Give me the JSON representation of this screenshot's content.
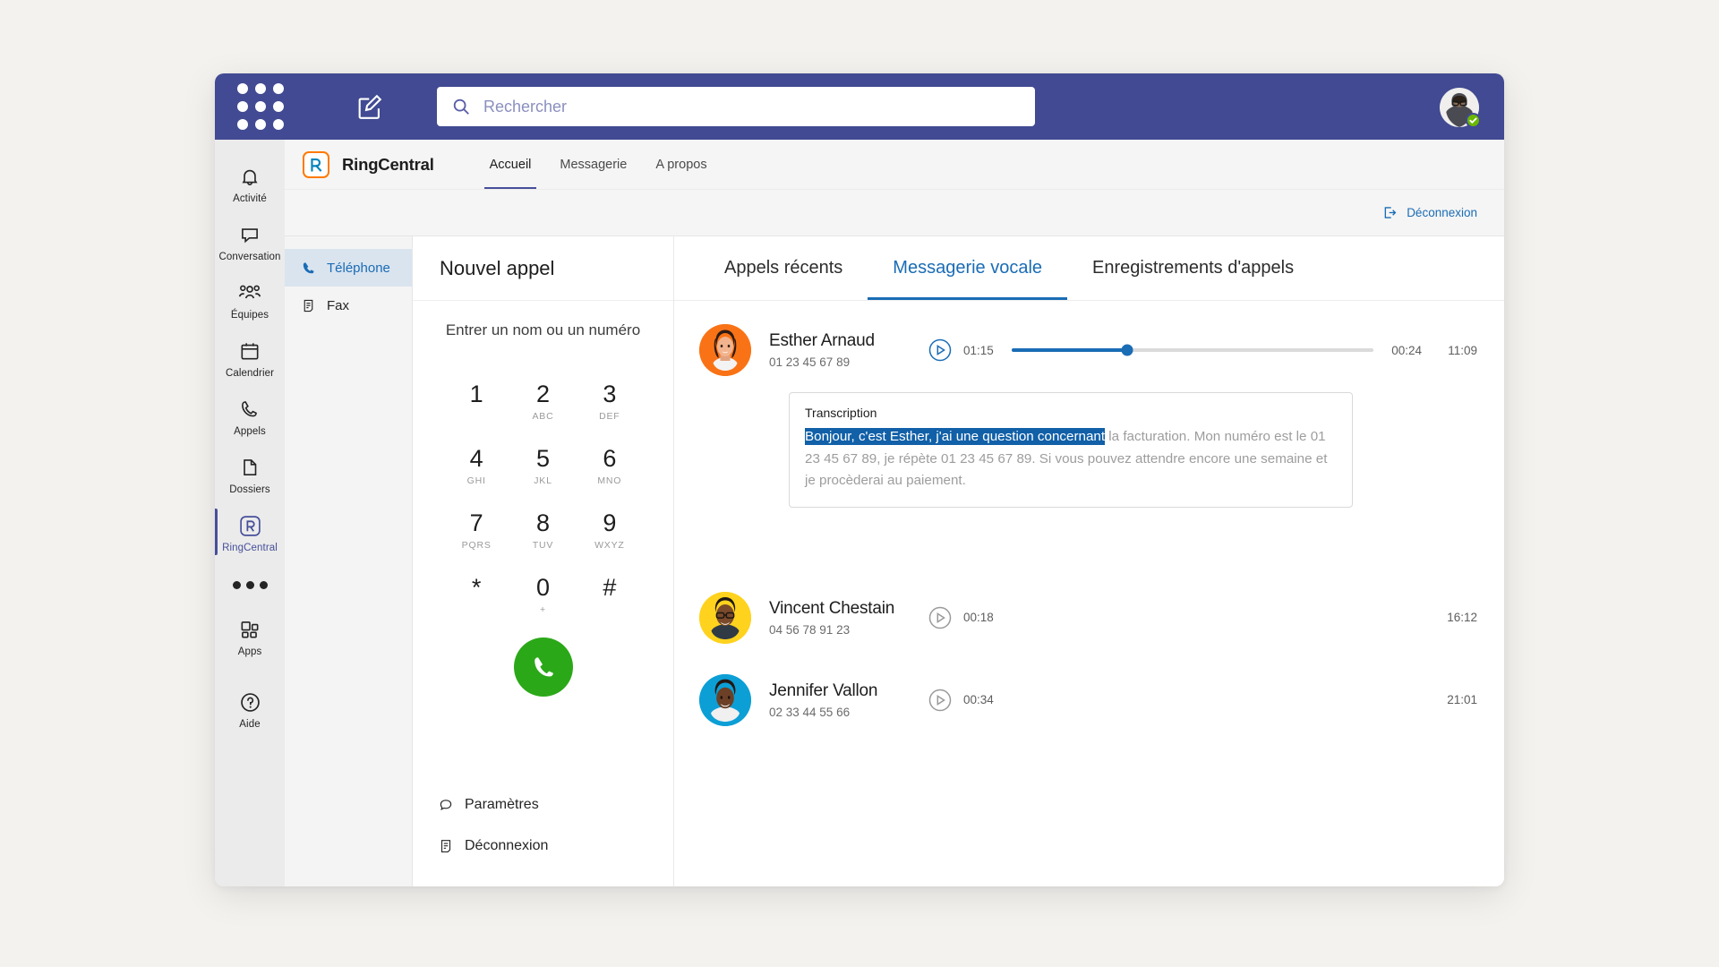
{
  "titlebar": {
    "waffle_icon": "grid-apps-icon",
    "compose_icon": "compose-pencil-icon",
    "search": {
      "icon": "search-icon",
      "value": "",
      "placeholder": "Rechercher"
    },
    "avatar": {
      "name": "user-avatar",
      "presence": "available"
    }
  },
  "left_rail": {
    "items": [
      {
        "label": "Activité",
        "icon": "bell-icon",
        "active": false
      },
      {
        "label": "Conversation",
        "icon": "chat-icon",
        "active": false
      },
      {
        "label": "Équipes",
        "icon": "people-icon",
        "active": false
      },
      {
        "label": "Calendrier",
        "icon": "calendar-icon",
        "active": false
      },
      {
        "label": "Appels",
        "icon": "phone-icon",
        "active": false
      },
      {
        "label": "Dossiers",
        "icon": "file-icon",
        "active": false
      },
      {
        "label": "RingCentral",
        "icon": "ringcentral-icon",
        "active": true
      }
    ],
    "more_icon": "more-dots-icon",
    "bottom_items": [
      {
        "label": "Apps",
        "icon": "apps-icon"
      },
      {
        "label": "Aide",
        "icon": "help-circle-icon"
      }
    ]
  },
  "app_header": {
    "logo_icon": "ringcentral-logo-icon",
    "title": "RingCentral",
    "tabs": [
      {
        "label": "Accueil",
        "active": true
      },
      {
        "label": "Messagerie",
        "active": false
      },
      {
        "label": "A propos",
        "active": false
      }
    ]
  },
  "logout_bar": {
    "icon": "logout-arrow-icon",
    "label": "Déconnexion"
  },
  "nav_pane": {
    "items": [
      {
        "label": "Téléphone",
        "icon": "phone-handset-icon",
        "active": true
      },
      {
        "label": "Fax",
        "icon": "fax-document-icon",
        "active": false
      }
    ]
  },
  "dialer": {
    "title": "Nouvel appel",
    "field_placeholder": "Entrer un nom ou un numéro",
    "field_value": "",
    "keys": [
      {
        "num": "1",
        "sub": ""
      },
      {
        "num": "2",
        "sub": "ABC"
      },
      {
        "num": "3",
        "sub": "DEF"
      },
      {
        "num": "4",
        "sub": "GHI"
      },
      {
        "num": "5",
        "sub": "JKL"
      },
      {
        "num": "6",
        "sub": "MNO"
      },
      {
        "num": "7",
        "sub": "PQRS"
      },
      {
        "num": "8",
        "sub": "TUV"
      },
      {
        "num": "9",
        "sub": "WXYZ"
      },
      {
        "num": "*",
        "sub": ""
      },
      {
        "num": "0",
        "sub": "+"
      },
      {
        "num": "#",
        "sub": ""
      }
    ],
    "call_button_icon": "phone-call-icon",
    "call_button_color": "#2ba818",
    "links": [
      {
        "label": "Paramètres",
        "icon": "settings-chat-icon"
      },
      {
        "label": "Déconnexion",
        "icon": "logout-document-icon"
      }
    ]
  },
  "voicemail": {
    "tabs": [
      {
        "label": "Appels récents",
        "active": false
      },
      {
        "label": "Messagerie vocale",
        "active": true
      },
      {
        "label": "Enregistrements d'appels",
        "active": false
      }
    ],
    "accent_color": "#1a6cb5",
    "items": [
      {
        "name": "Esther Arnaud",
        "number": "01 23 45 67 89",
        "elapsed": "01:15",
        "remaining": "00:24",
        "clock": "11:09",
        "playing": true,
        "progress_pct": 32,
        "avatar_bg": "#f97316"
      },
      {
        "name": "Vincent Chestain",
        "number": "04 56 78 91 23",
        "elapsed": "00:18",
        "remaining": "",
        "clock": "16:12",
        "playing": false,
        "progress_pct": 0,
        "avatar_bg": "#ffd21e"
      },
      {
        "name": "Jennifer Vallon",
        "number": "02 33 44 55 66",
        "elapsed": "00:34",
        "remaining": "",
        "clock": "21:01",
        "playing": false,
        "progress_pct": 0,
        "avatar_bg": "#0c9fd6"
      }
    ],
    "transcription": {
      "label": "Transcription",
      "highlighted": "Bonjour, c'est Esther, j'ai une question concernant",
      "rest": " la facturation. Mon numéro est le 01 23 45 67 89, je répète 01 23 45 67 89. Si vous pouvez attendre encore une semaine et je procèderai au paiement.",
      "highlight_color": "#1160a8"
    }
  }
}
